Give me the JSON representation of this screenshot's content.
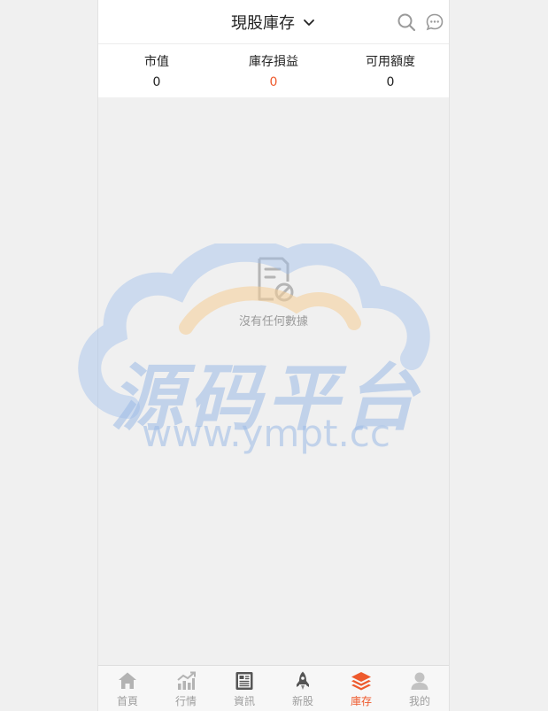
{
  "header": {
    "title": "現股庫存",
    "icons": [
      "search-icon",
      "chat-icon",
      "chevron-down-icon"
    ]
  },
  "summary": {
    "market_value_label": "市值",
    "market_value": "0",
    "pnl_label": "庫存損益",
    "pnl": "0",
    "available_label": "可用額度",
    "available": "0"
  },
  "empty": {
    "text": "沒有任何數據"
  },
  "watermark": {
    "cn": "源码平台",
    "en": "www.ympt.cc"
  },
  "tabs": [
    {
      "label": "首頁",
      "icon": "home-icon"
    },
    {
      "label": "行情",
      "icon": "chart-icon"
    },
    {
      "label": "資訊",
      "icon": "news-icon"
    },
    {
      "label": "新股",
      "icon": "rocket-icon"
    },
    {
      "label": "庫存",
      "icon": "layers-icon",
      "active": true
    },
    {
      "label": "我的",
      "icon": "user-icon"
    }
  ],
  "colors": {
    "accent": "#ee5a2d",
    "inactive": "#9e9e9e",
    "background": "#f0f0f0"
  }
}
